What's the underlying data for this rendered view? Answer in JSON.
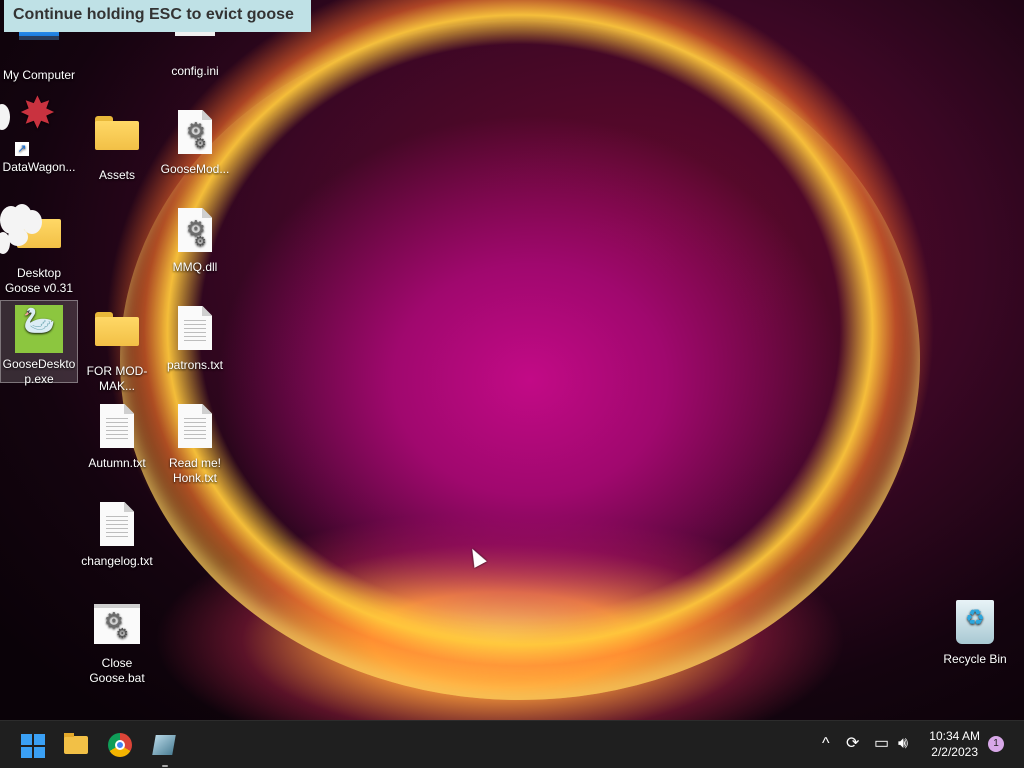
{
  "banner": {
    "text": "Continue holding ESC to evict goose"
  },
  "desktop": {
    "icons": [
      {
        "label": "My Computer"
      },
      {
        "label": "config.ini"
      },
      {
        "label": "DataWagon..."
      },
      {
        "label": "Assets"
      },
      {
        "label": "GooseMod..."
      },
      {
        "label": "Desktop Goose v0.31"
      },
      {
        "label": "MMQ.dll"
      },
      {
        "label": "GooseDesktop.exe"
      },
      {
        "label": "FOR MOD-MAK..."
      },
      {
        "label": "patrons.txt"
      },
      {
        "label": "Autumn.txt"
      },
      {
        "label": "Read me! Honk.txt"
      },
      {
        "label": "changelog.txt"
      },
      {
        "label": "Close Goose.bat"
      },
      {
        "label": "Recycle Bin"
      }
    ]
  },
  "taskbar": {
    "apps": [
      "Start",
      "File Explorer",
      "Google Chrome",
      "Desktop Goose"
    ],
    "tray": {
      "up_arrow": "^"
    },
    "clock": {
      "time": "10:34 AM",
      "date": "2/2/2023"
    },
    "notifications": {
      "count": "1"
    }
  },
  "colors": {
    "taskbar": "#1f1f1f",
    "banner": "#bfe1e6",
    "accent": "#3aa0f5"
  }
}
